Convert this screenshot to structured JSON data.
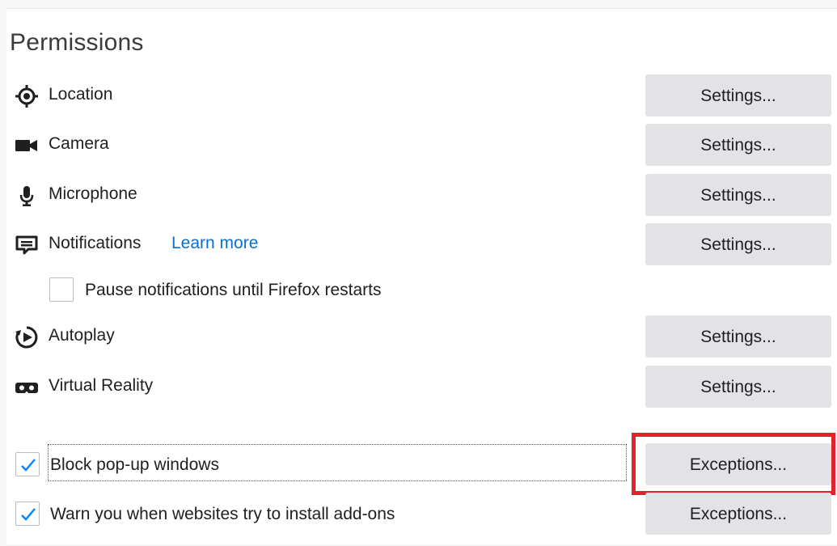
{
  "section": {
    "title": "Permissions"
  },
  "permissions": [
    {
      "label": "Location",
      "icon": "location-icon",
      "button": "Settings..."
    },
    {
      "label": "Camera",
      "icon": "camera-icon",
      "button": "Settings..."
    },
    {
      "label": "Microphone",
      "icon": "microphone-icon",
      "button": "Settings..."
    },
    {
      "label": "Notifications",
      "icon": "notifications-icon",
      "button": "Settings...",
      "link": "Learn more"
    },
    {
      "label": "Autoplay",
      "icon": "autoplay-icon",
      "button": "Settings..."
    },
    {
      "label": "Virtual Reality",
      "icon": "vr-headset-icon",
      "button": "Settings..."
    }
  ],
  "pause_notifications": {
    "label": "Pause notifications until Firefox restarts",
    "checked": false
  },
  "block_popups": {
    "label": "Block pop-up windows",
    "checked": true,
    "button": "Exceptions..."
  },
  "warn_addons": {
    "label": "Warn you when websites try to install add-ons",
    "checked": true,
    "button": "Exceptions..."
  },
  "colors": {
    "link": "#0a6fd1",
    "button_bg": "#e3e3e5",
    "checkmark": "#0a84ff",
    "highlight": "#e3222b"
  }
}
